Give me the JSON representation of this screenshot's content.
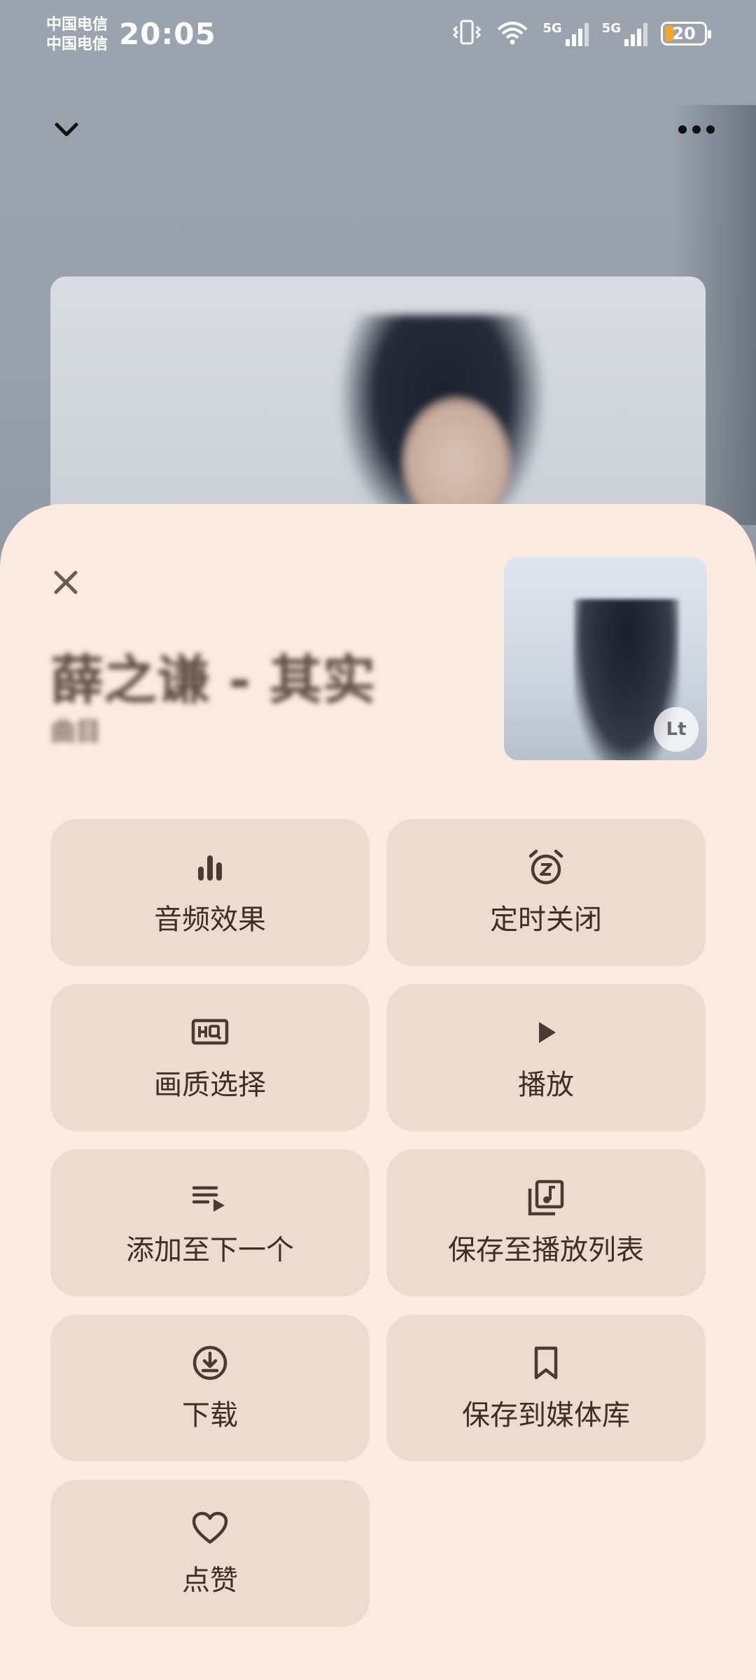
{
  "status_bar": {
    "carrier_1": "中国电信",
    "carrier_2": "中国电信",
    "time": "20:05",
    "network_1": "5G",
    "network_2": "5G",
    "battery": "20"
  },
  "header": {
    "collapse_icon": "chevron-down-icon",
    "more_icon": "more-horizontal-icon"
  },
  "sheet": {
    "close_icon": "close-icon",
    "song_title": "薛之谦 - 其实",
    "song_subtitle": "曲目",
    "thumb_badge": "Lt",
    "actions": [
      {
        "label": "音频效果",
        "icon": "equalizer-icon"
      },
      {
        "label": "定时关闭",
        "icon": "alarm-timer-icon"
      },
      {
        "label": "画质选择",
        "icon": "hq-icon"
      },
      {
        "label": "播放",
        "icon": "play-icon"
      },
      {
        "label": "添加至下一个",
        "icon": "queue-next-icon"
      },
      {
        "label": "保存至播放列表",
        "icon": "playlist-add-icon"
      },
      {
        "label": "下载",
        "icon": "download-icon"
      },
      {
        "label": "保存到媒体库",
        "icon": "bookmark-icon"
      },
      {
        "label": "点赞",
        "icon": "heart-icon"
      }
    ]
  },
  "colors": {
    "sheet_bg": "#fbeae0",
    "tile_bg": "#ecdcd0",
    "text": "#3e2e27",
    "battery_accent": "#f6a623"
  }
}
